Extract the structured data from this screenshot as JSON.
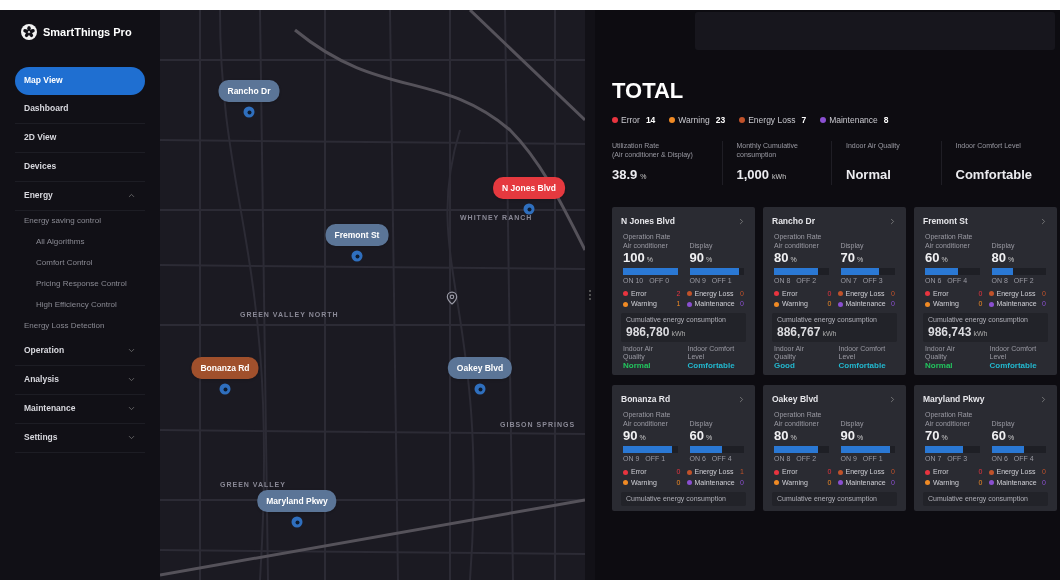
{
  "app": {
    "name": "SmartThings Pro"
  },
  "sidebar": {
    "items": [
      {
        "label": "Map View",
        "selected": true
      },
      {
        "label": "Dashboard",
        "selected": false
      },
      {
        "label": "2D View",
        "selected": false
      },
      {
        "label": "Devices",
        "selected": false
      },
      {
        "label": "Energy",
        "selected": false,
        "expanded": true,
        "children": [
          {
            "label": "Energy saving control",
            "selected": false,
            "children": [
              {
                "label": "All Algorithms",
                "selected": false
              },
              {
                "label": "Comfort Control",
                "selected": false
              },
              {
                "label": "Pricing Response Control",
                "selected": false
              },
              {
                "label": "High Efficiency Control",
                "selected": false
              }
            ]
          },
          {
            "label": "Energy Loss Detection",
            "selected": false
          }
        ]
      },
      {
        "label": "Operation",
        "selected": false,
        "expanded": false
      },
      {
        "label": "Analysis",
        "selected": false,
        "expanded": false
      },
      {
        "label": "Maintenance",
        "selected": false,
        "expanded": false
      },
      {
        "label": "Settings",
        "selected": false,
        "expanded": false
      }
    ]
  },
  "map": {
    "markers": [
      {
        "label": "Rancho Dr",
        "color": "#5b7597"
      },
      {
        "label": "N Jones Blvd",
        "color": "#e5393f"
      },
      {
        "label": "Fremont St",
        "color": "#5b7597"
      },
      {
        "label": "Bonanza Rd",
        "color": "#a0502c"
      },
      {
        "label": "Oakey Blvd",
        "color": "#5b7597"
      },
      {
        "label": "Maryland Pkwy",
        "color": "#5b7597"
      }
    ],
    "areas": [
      "WHITNEY RANCH",
      "GREEN VALLEY NORTH",
      "GIBSON SPRINGS",
      "GREEN VALLEY"
    ]
  },
  "total": {
    "title": "TOTAL",
    "statuses": [
      {
        "label": "Error",
        "count": "14",
        "color": "#e8343f"
      },
      {
        "label": "Warning",
        "count": "23",
        "color": "#f08a24"
      },
      {
        "label": "Energy Loss",
        "count": "7",
        "color": "#c0522a"
      },
      {
        "label": "Maintenance",
        "count": "8",
        "color": "#8a4fd0"
      }
    ],
    "stats": [
      {
        "label": "Utilization Rate\n(Air conditioner & Display)",
        "value": "38.9",
        "unit": "%"
      },
      {
        "label": "Monthly Cumulative\nconsumption",
        "value": "1,000",
        "unit": "kWh"
      },
      {
        "label": "Indoor Air Quality",
        "value": "Normal"
      },
      {
        "label": "Indoor Comfort Level",
        "value": "Comfortable"
      }
    ]
  },
  "cards": [
    {
      "name": "N Jones Blvd",
      "operation_label": "Operation Rate",
      "meters": [
        {
          "label": "Air conditioner",
          "value": "100",
          "unit": "%",
          "level": 1.0,
          "on": "ON 10",
          "off": "OFF 0"
        },
        {
          "label": "Display",
          "value": "90",
          "unit": "%",
          "level": 0.9,
          "on": "ON 9",
          "off": "OFF 1"
        }
      ],
      "statuses": [
        {
          "label": "Error",
          "count": "2",
          "color": "#e8343f"
        },
        {
          "label": "Energy Loss",
          "count": "0",
          "color": "#c0522a"
        },
        {
          "label": "Warning",
          "count": "1",
          "color": "#f08a24"
        },
        {
          "label": "Maintenance",
          "count": "0",
          "color": "#8a4fd0"
        }
      ],
      "consumption": {
        "label": "Cumulative energy consumption",
        "value": "986,780",
        "unit": "kWh"
      },
      "conditions": [
        {
          "label": "Indoor Air\nQuality",
          "value": "Normal",
          "color": "#22c55e"
        },
        {
          "label": "Indoor Comfort\nLevel",
          "value": "Comfortable",
          "color": "#22b8cf"
        }
      ]
    },
    {
      "name": "Rancho Dr",
      "operation_label": "Operation Rate",
      "meters": [
        {
          "label": "Air conditioner",
          "value": "80",
          "unit": "%",
          "level": 0.8,
          "on": "ON 8",
          "off": "OFF 2"
        },
        {
          "label": "Display",
          "value": "70",
          "unit": "%",
          "level": 0.7,
          "on": "ON 7",
          "off": "OFF 3"
        }
      ],
      "statuses": [
        {
          "label": "Error",
          "count": "0",
          "color": "#e8343f"
        },
        {
          "label": "Energy Loss",
          "count": "0",
          "color": "#c0522a"
        },
        {
          "label": "Warning",
          "count": "0",
          "color": "#f08a24"
        },
        {
          "label": "Maintenance",
          "count": "0",
          "color": "#8a4fd0"
        }
      ],
      "consumption": {
        "label": "Cumulative energy consumption",
        "value": "886,767",
        "unit": "kWh"
      },
      "conditions": [
        {
          "label": "Indoor Air\nQuality",
          "value": "Good",
          "color": "#22b8cf"
        },
        {
          "label": "Indoor Comfort\nLevel",
          "value": "Comfortable",
          "color": "#22b8cf"
        }
      ]
    },
    {
      "name": "Fremont St",
      "operation_label": "Operation Rate",
      "meters": [
        {
          "label": "Air conditioner",
          "value": "60",
          "unit": "%",
          "level": 0.6,
          "on": "ON 6",
          "off": "OFF 4"
        },
        {
          "label": "Display",
          "value": "80",
          "unit": "%",
          "level": 0.4,
          "on": "ON 8",
          "off": "OFF 2"
        }
      ],
      "statuses": [
        {
          "label": "Error",
          "count": "0",
          "color": "#e8343f"
        },
        {
          "label": "Energy Loss",
          "count": "0",
          "color": "#c0522a"
        },
        {
          "label": "Warning",
          "count": "0",
          "color": "#f08a24"
        },
        {
          "label": "Maintenance",
          "count": "0",
          "color": "#8a4fd0"
        }
      ],
      "consumption": {
        "label": "Cumulative energy consumption",
        "value": "986,743",
        "unit": "kWh"
      },
      "conditions": [
        {
          "label": "Indoor Air\nQuality",
          "value": "Normal",
          "color": "#22c55e"
        },
        {
          "label": "Indoor Comfort\nLevel",
          "value": "Comfortable",
          "color": "#22b8cf"
        }
      ]
    },
    {
      "name": "Bonanza Rd",
      "operation_label": "Operation Rate",
      "meters": [
        {
          "label": "Air conditioner",
          "value": "90",
          "unit": "%",
          "level": 0.9,
          "on": "ON 9",
          "off": "OFF 1"
        },
        {
          "label": "Display",
          "value": "60",
          "unit": "%",
          "level": 0.6,
          "on": "ON 6",
          "off": "OFF 4"
        }
      ],
      "statuses": [
        {
          "label": "Error",
          "count": "0",
          "color": "#e8343f"
        },
        {
          "label": "Energy Loss",
          "count": "1",
          "color": "#c0522a"
        },
        {
          "label": "Warning",
          "count": "0",
          "color": "#f08a24"
        },
        {
          "label": "Maintenance",
          "count": "0",
          "color": "#8a4fd0"
        }
      ],
      "consumption": {
        "label": "Cumulative energy consumption"
      }
    },
    {
      "name": "Oakey Blvd",
      "operation_label": "Operation Rate",
      "meters": [
        {
          "label": "Air conditioner",
          "value": "80",
          "unit": "%",
          "level": 0.8,
          "on": "ON 8",
          "off": "OFF 2"
        },
        {
          "label": "Display",
          "value": "90",
          "unit": "%",
          "level": 0.9,
          "on": "ON 9",
          "off": "OFF 1"
        }
      ],
      "statuses": [
        {
          "label": "Error",
          "count": "0",
          "color": "#e8343f"
        },
        {
          "label": "Energy Loss",
          "count": "0",
          "color": "#c0522a"
        },
        {
          "label": "Warning",
          "count": "0",
          "color": "#f08a24"
        },
        {
          "label": "Maintenance",
          "count": "0",
          "color": "#8a4fd0"
        }
      ],
      "consumption": {
        "label": "Cumulative energy consumption"
      }
    },
    {
      "name": "Maryland Pkwy",
      "operation_label": "Operation Rate",
      "meters": [
        {
          "label": "Air conditioner",
          "value": "70",
          "unit": "%",
          "level": 0.7,
          "on": "ON 7",
          "off": "OFF 3"
        },
        {
          "label": "Display",
          "value": "60",
          "unit": "%",
          "level": 0.6,
          "on": "ON 6",
          "off": "OFF 4"
        }
      ],
      "statuses": [
        {
          "label": "Error",
          "count": "0",
          "color": "#e8343f"
        },
        {
          "label": "Energy Loss",
          "count": "0",
          "color": "#c0522a"
        },
        {
          "label": "Warning",
          "count": "0",
          "color": "#f08a24"
        },
        {
          "label": "Maintenance",
          "count": "0",
          "color": "#8a4fd0"
        }
      ],
      "consumption": {
        "label": "Cumulative energy consumption"
      }
    }
  ]
}
